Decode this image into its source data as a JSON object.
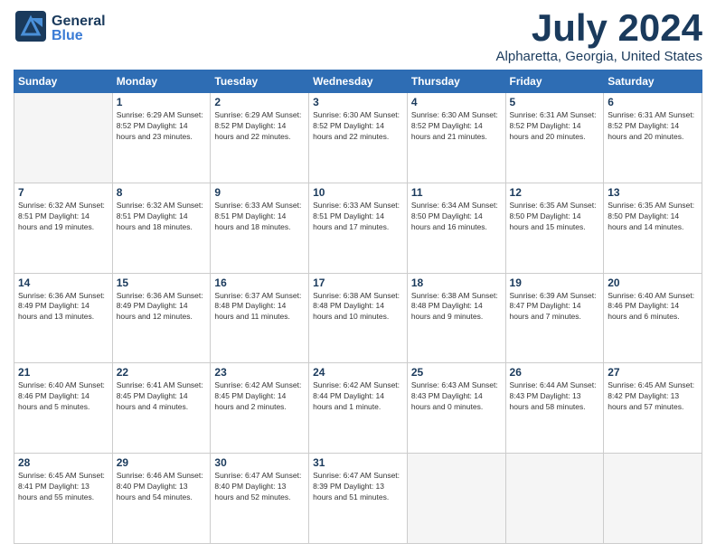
{
  "header": {
    "logo_general": "General",
    "logo_blue": "Blue",
    "month_title": "July 2024",
    "location": "Alpharetta, Georgia, United States"
  },
  "days_of_week": [
    "Sunday",
    "Monday",
    "Tuesday",
    "Wednesday",
    "Thursday",
    "Friday",
    "Saturday"
  ],
  "weeks": [
    [
      {
        "day": "",
        "info": ""
      },
      {
        "day": "1",
        "info": "Sunrise: 6:29 AM\nSunset: 8:52 PM\nDaylight: 14 hours\nand 23 minutes."
      },
      {
        "day": "2",
        "info": "Sunrise: 6:29 AM\nSunset: 8:52 PM\nDaylight: 14 hours\nand 22 minutes."
      },
      {
        "day": "3",
        "info": "Sunrise: 6:30 AM\nSunset: 8:52 PM\nDaylight: 14 hours\nand 22 minutes."
      },
      {
        "day": "4",
        "info": "Sunrise: 6:30 AM\nSunset: 8:52 PM\nDaylight: 14 hours\nand 21 minutes."
      },
      {
        "day": "5",
        "info": "Sunrise: 6:31 AM\nSunset: 8:52 PM\nDaylight: 14 hours\nand 20 minutes."
      },
      {
        "day": "6",
        "info": "Sunrise: 6:31 AM\nSunset: 8:52 PM\nDaylight: 14 hours\nand 20 minutes."
      }
    ],
    [
      {
        "day": "7",
        "info": "Sunrise: 6:32 AM\nSunset: 8:51 PM\nDaylight: 14 hours\nand 19 minutes."
      },
      {
        "day": "8",
        "info": "Sunrise: 6:32 AM\nSunset: 8:51 PM\nDaylight: 14 hours\nand 18 minutes."
      },
      {
        "day": "9",
        "info": "Sunrise: 6:33 AM\nSunset: 8:51 PM\nDaylight: 14 hours\nand 18 minutes."
      },
      {
        "day": "10",
        "info": "Sunrise: 6:33 AM\nSunset: 8:51 PM\nDaylight: 14 hours\nand 17 minutes."
      },
      {
        "day": "11",
        "info": "Sunrise: 6:34 AM\nSunset: 8:50 PM\nDaylight: 14 hours\nand 16 minutes."
      },
      {
        "day": "12",
        "info": "Sunrise: 6:35 AM\nSunset: 8:50 PM\nDaylight: 14 hours\nand 15 minutes."
      },
      {
        "day": "13",
        "info": "Sunrise: 6:35 AM\nSunset: 8:50 PM\nDaylight: 14 hours\nand 14 minutes."
      }
    ],
    [
      {
        "day": "14",
        "info": "Sunrise: 6:36 AM\nSunset: 8:49 PM\nDaylight: 14 hours\nand 13 minutes."
      },
      {
        "day": "15",
        "info": "Sunrise: 6:36 AM\nSunset: 8:49 PM\nDaylight: 14 hours\nand 12 minutes."
      },
      {
        "day": "16",
        "info": "Sunrise: 6:37 AM\nSunset: 8:48 PM\nDaylight: 14 hours\nand 11 minutes."
      },
      {
        "day": "17",
        "info": "Sunrise: 6:38 AM\nSunset: 8:48 PM\nDaylight: 14 hours\nand 10 minutes."
      },
      {
        "day": "18",
        "info": "Sunrise: 6:38 AM\nSunset: 8:48 PM\nDaylight: 14 hours\nand 9 minutes."
      },
      {
        "day": "19",
        "info": "Sunrise: 6:39 AM\nSunset: 8:47 PM\nDaylight: 14 hours\nand 7 minutes."
      },
      {
        "day": "20",
        "info": "Sunrise: 6:40 AM\nSunset: 8:46 PM\nDaylight: 14 hours\nand 6 minutes."
      }
    ],
    [
      {
        "day": "21",
        "info": "Sunrise: 6:40 AM\nSunset: 8:46 PM\nDaylight: 14 hours\nand 5 minutes."
      },
      {
        "day": "22",
        "info": "Sunrise: 6:41 AM\nSunset: 8:45 PM\nDaylight: 14 hours\nand 4 minutes."
      },
      {
        "day": "23",
        "info": "Sunrise: 6:42 AM\nSunset: 8:45 PM\nDaylight: 14 hours\nand 2 minutes."
      },
      {
        "day": "24",
        "info": "Sunrise: 6:42 AM\nSunset: 8:44 PM\nDaylight: 14 hours\nand 1 minute."
      },
      {
        "day": "25",
        "info": "Sunrise: 6:43 AM\nSunset: 8:43 PM\nDaylight: 14 hours\nand 0 minutes."
      },
      {
        "day": "26",
        "info": "Sunrise: 6:44 AM\nSunset: 8:43 PM\nDaylight: 13 hours\nand 58 minutes."
      },
      {
        "day": "27",
        "info": "Sunrise: 6:45 AM\nSunset: 8:42 PM\nDaylight: 13 hours\nand 57 minutes."
      }
    ],
    [
      {
        "day": "28",
        "info": "Sunrise: 6:45 AM\nSunset: 8:41 PM\nDaylight: 13 hours\nand 55 minutes."
      },
      {
        "day": "29",
        "info": "Sunrise: 6:46 AM\nSunset: 8:40 PM\nDaylight: 13 hours\nand 54 minutes."
      },
      {
        "day": "30",
        "info": "Sunrise: 6:47 AM\nSunset: 8:40 PM\nDaylight: 13 hours\nand 52 minutes."
      },
      {
        "day": "31",
        "info": "Sunrise: 6:47 AM\nSunset: 8:39 PM\nDaylight: 13 hours\nand 51 minutes."
      },
      {
        "day": "",
        "info": ""
      },
      {
        "day": "",
        "info": ""
      },
      {
        "day": "",
        "info": ""
      }
    ]
  ]
}
